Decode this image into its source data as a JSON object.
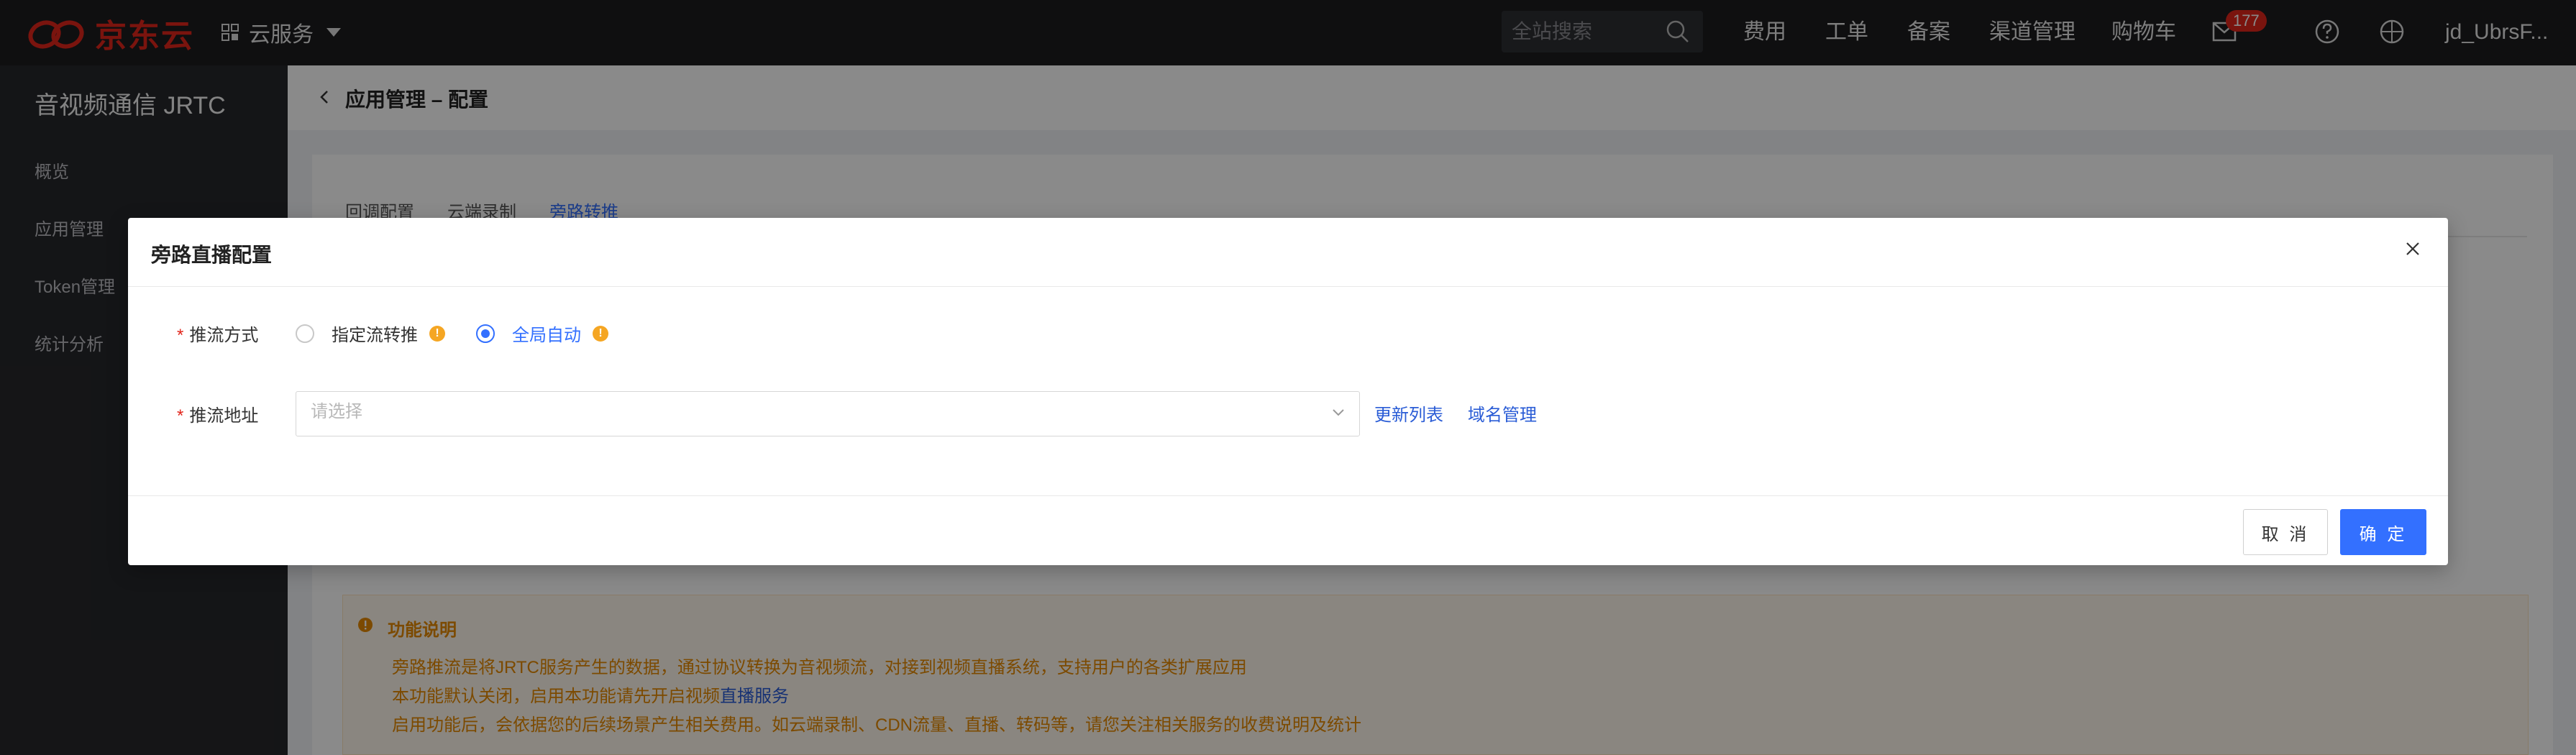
{
  "colors": {
    "accent": "#3370ff",
    "brand": "#e1251b",
    "warning": "#e68a00"
  },
  "topbar": {
    "brand_name": "京东云",
    "cloud_services_label": "云服务",
    "search": {
      "placeholder": "全站搜索"
    },
    "links": [
      "费用",
      "工单",
      "备案",
      "渠道管理",
      "购物车"
    ],
    "mail_badge": "177",
    "user": "jd_UbrsF..."
  },
  "sidebar": {
    "title": "音视频通信 JRTC",
    "items": [
      {
        "label": "概览"
      },
      {
        "label": "应用管理"
      },
      {
        "label": "Token管理"
      },
      {
        "label": "统计分析"
      }
    ]
  },
  "main": {
    "breadcrumb_title": "应用管理 – 配置",
    "tabs": [
      "回调配置",
      "云端录制",
      "旁路转推"
    ],
    "notice": {
      "title": "功能说明",
      "line1": "旁路推流是将JRTC服务产生的数据，通过协议转换为音视频流，对接到视频直播系统，支持用户的各类扩展应用",
      "line2_prefix": "本功能默认关闭，启用本功能请先开启视频",
      "line2_link": "直播服务",
      "line3": "启用功能后，会依据您的后续场景产生相关费用。如云端录制、CDN流量、直播、转码等，请您关注相关服务的收费说明及统计"
    }
  },
  "modal": {
    "title": "旁路直播配置",
    "push_mode": {
      "label": "推流方式",
      "options": [
        {
          "label": "指定流转推",
          "checked": false
        },
        {
          "label": "全局自动",
          "checked": true
        }
      ]
    },
    "push_address": {
      "label": "推流地址",
      "placeholder": "请选择",
      "refresh_label": "更新列表",
      "domain_label": "域名管理"
    },
    "cancel_label": "取 消",
    "confirm_label": "确 定"
  }
}
